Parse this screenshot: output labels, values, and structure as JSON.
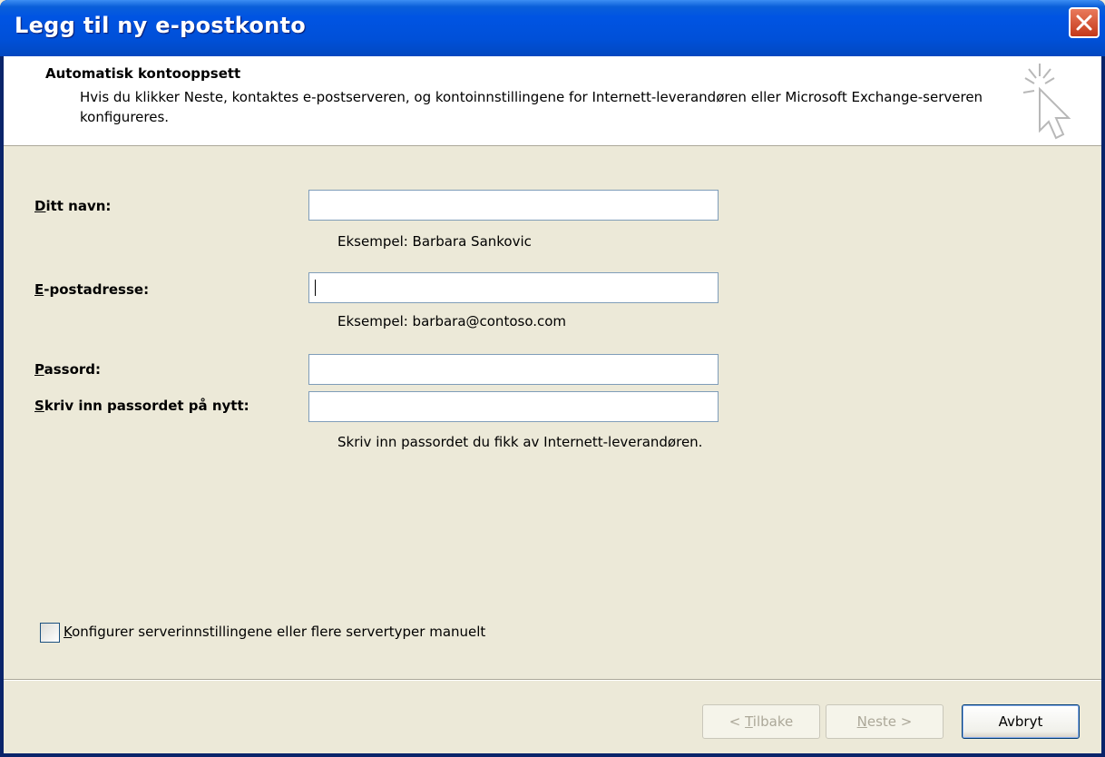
{
  "window": {
    "title": "Legg til ny e-postkonto"
  },
  "header": {
    "title": "Automatisk kontooppsett",
    "description": "Hvis du klikker Neste, kontaktes e-postserveren, og kontoinnstillingene for Internett-leverandøren eller Microsoft Exchange-serveren konfigureres."
  },
  "form": {
    "name": {
      "label_first": "D",
      "label_rest": "itt navn:",
      "value": "",
      "hint": "Eksempel: Barbara Sankovic"
    },
    "email": {
      "label_first": "E",
      "label_rest": "-postadresse:",
      "value": "",
      "hint": "Eksempel: barbara@contoso.com"
    },
    "password": {
      "label_first": "P",
      "label_rest": "assord:",
      "value": ""
    },
    "password_repeat": {
      "label_first": "S",
      "label_rest": "kriv inn passordet på nytt:",
      "value": "",
      "hint": "Skriv inn passordet du fikk av Internett-leverandøren."
    }
  },
  "manual_config": {
    "label_first": "K",
    "label_rest": "onfigurer serverinnstillingene eller flere servertyper manuelt",
    "checked": false
  },
  "buttons": {
    "back_prefix": "< ",
    "back_first": "T",
    "back_rest": "ilbake",
    "next_first": "N",
    "next_rest": "este >",
    "cancel": "Avbryt"
  },
  "icons": {
    "close": "close-icon",
    "wizard": "cursor-sparkle-icon"
  }
}
